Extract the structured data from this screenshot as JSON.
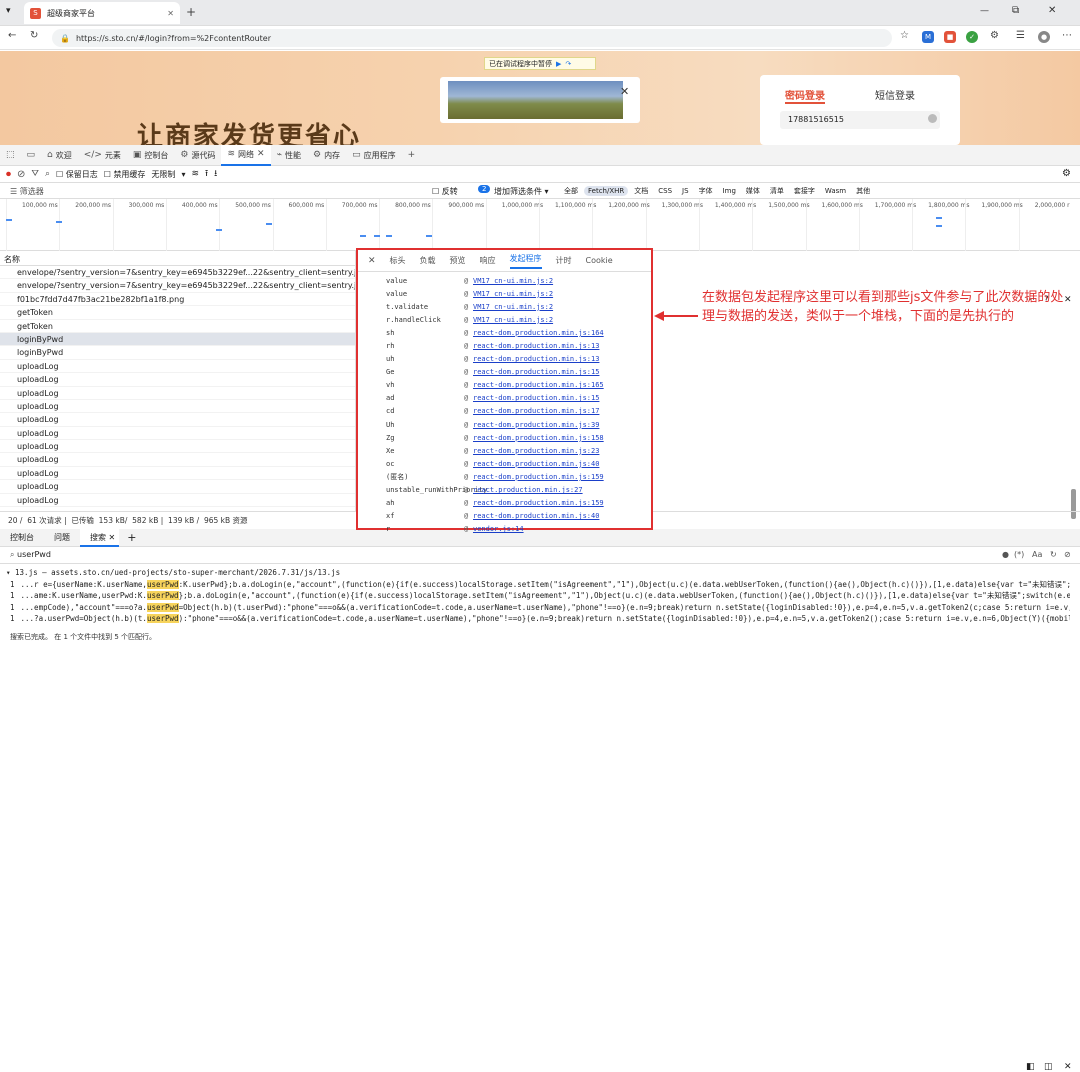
{
  "browser": {
    "tab_title": "超级商家平台",
    "url": "https://s.sto.cn/#/login?from=%2FcontentRouter"
  },
  "page": {
    "debug_banner": "已在调试程序中暂停",
    "slogan": "让商家发货更省心",
    "login_tab_active": "密码登录",
    "login_tab_other": "短信登录",
    "phone_value": "17881516515"
  },
  "devtools": {
    "tabs": [
      "欢迎",
      "元素",
      "控制台",
      "源代码",
      "网络",
      "性能",
      "内存",
      "应用程序"
    ],
    "toolbar": {
      "preserve_log": "保留日志",
      "disable_cache": "禁用缓存",
      "throttle": "无限制"
    },
    "filter": {
      "placeholder": "筛选器",
      "invert": "反转",
      "more_filters": "增加筛选条件",
      "badge": "2",
      "types": [
        "全部",
        "Fetch/XHR",
        "文档",
        "CSS",
        "JS",
        "字体",
        "Img",
        "媒体",
        "清单",
        "套接字",
        "Wasm",
        "其他"
      ]
    },
    "timeline_ticks": [
      "100,000 ms",
      "200,000 ms",
      "300,000 ms",
      "400,000 ms",
      "500,000 ms",
      "600,000 ms",
      "700,000 ms",
      "800,000 ms",
      "900,000 ms",
      "1,000,000 ms",
      "1,100,000 ms",
      "1,200,000 ms",
      "1,300,000 ms",
      "1,400,000 ms",
      "1,500,000 ms",
      "1,600,000 ms",
      "1,700,000 ms",
      "1,800,000 ms",
      "1,900,000 ms",
      "2,000,000 r"
    ],
    "requests_header": "名称",
    "requests": [
      "envelope/?sentry_version=7&sentry_key=e6945b3229ef...22&sentry_client=sentry.javas...",
      "envelope/?sentry_version=7&sentry_key=e6945b3229ef...22&sentry_client=sentry.javas...",
      "f01bc7fdd7d47fb3ac21be282bf1a1f8.png",
      "getToken",
      "getToken",
      "loginByPwd",
      "loginByPwd",
      "uploadLog",
      "uploadLog",
      "uploadLog",
      "uploadLog",
      "uploadLog",
      "uploadLog",
      "uploadLog",
      "uploadLog",
      "uploadLog",
      "uploadLog",
      "uploadLog"
    ],
    "status": {
      "count": "20 /",
      "requests": "61 次请求",
      "transferred": "已传输",
      "t1": "153 kB/",
      "t2": "582 kB",
      "t3": "139 kB /",
      "t4": "965 kB 资源"
    },
    "panel_tabs": [
      "标头",
      "负载",
      "预览",
      "响应",
      "发起程序",
      "计时",
      "Cookie"
    ],
    "initiator": [
      {
        "fn": "value",
        "src": "VM17 cn-ui.min.js:2"
      },
      {
        "fn": "value",
        "src": "VM17 cn-ui.min.js:2"
      },
      {
        "fn": "t.validate",
        "src": "VM17 cn-ui.min.js:2"
      },
      {
        "fn": "r.handleClick",
        "src": "VM17 cn-ui.min.js:2"
      },
      {
        "fn": "sh",
        "src": "react-dom.production.min.js:164"
      },
      {
        "fn": "rh",
        "src": "react-dom.production.min.js:13"
      },
      {
        "fn": "uh",
        "src": "react-dom.production.min.js:13"
      },
      {
        "fn": "Ge",
        "src": "react-dom.production.min.js:15"
      },
      {
        "fn": "vh",
        "src": "react-dom.production.min.js:165"
      },
      {
        "fn": "ad",
        "src": "react-dom.production.min.js:15"
      },
      {
        "fn": "cd",
        "src": "react-dom.production.min.js:17"
      },
      {
        "fn": "Uh",
        "src": "react-dom.production.min.js:39"
      },
      {
        "fn": "Zg",
        "src": "react-dom.production.min.js:158"
      },
      {
        "fn": "Xe",
        "src": "react-dom.production.min.js:23"
      },
      {
        "fn": "oc",
        "src": "react-dom.production.min.js:40"
      },
      {
        "fn": "(匿名)",
        "src": "react-dom.production.min.js:159"
      },
      {
        "fn": "unstable_runWithPriority",
        "src": "react.production.min.js:27"
      },
      {
        "fn": "ah",
        "src": "react-dom.production.min.js:159"
      },
      {
        "fn": "xf",
        "src": "react-dom.production.min.js:40"
      },
      {
        "fn": "r",
        "src": "vendor.js:14"
      }
    ],
    "drawer_tabs": [
      "控制台",
      "问题",
      "搜索"
    ],
    "search_query": "userPwd",
    "search_file": "▾ 13.js — assets.sto.cn/ued-projects/sto-super-merchant/2026.7.31/js/13.js",
    "search_results": [
      {
        "ln": "1",
        "pre": "...r e={userName:K.userName,",
        "hl": "userPwd",
        "post": ":K.userPwd};b.a.doLogin(e,\"account\",(function(e){if(e.success)localStorage.setItem(\"isAgreement\",\"1\"),Object(u.c)(e.data.webUserToken,(function(){ae(),Object(h.c)()}),[1,e.data)else{var t=\"未知错误\";switch(e.errorCode){case\"101\":t=\"您还没有注册，请..."
      },
      {
        "ln": "1",
        "pre": "...ame:K.userName,userPwd:K.",
        "hl": "userPwd",
        "post": "};b.a.doLogin(e,\"account\",(function(e){if(e.success)localStorage.setItem(\"isAgreement\",\"1\"),Object(u.c)(e.data.webUserToken,(function(){ae(),Object(h.c)()}),[1,e.data)else{var t=\"未知错误\";switch(e.errorCode){case\"101\":t=\"您还没有注册，请立即注册\";brea..."
      },
      {
        "ln": "1",
        "pre": "...empCode),\"account\"===o?a.",
        "hl": "userPwd",
        "post": "=Object(h.b)(t.userPwd):\"phone\"===o&&(a.verificationCode=t.code,a.userName=t.userName),\"phone\"!==o}(e.n=9;break)return n.setState({loginDisabled:!0}),e.p=4,e.n=5,v.a.getToken2(c;case 5:return i=e.v,e.n=6,Object(Y)({mobile:t.userName,acc..."
      },
      {
        "ln": "1",
        "pre": "...?a.userPwd=Object(h.b)(t.",
        "hl": "userPwd",
        "post": "):\"phone\"===o&&(a.verificationCode=t.code,a.userName=t.userName),\"phone\"!==o}(e.n=9;break)return n.setState({loginDisabled:!0}),e.p=4,e.n=5,v.a.getToken2();case 5:return i=e.v,e.n=6,Object(Y)({mobile:t.userName,accessToken:i.data});case 6:if(c..."
      }
    ],
    "search_summary": "搜索已完成。 在 1 个文件中找到 5 个匹配行。"
  },
  "annotation": "在数据包发起程序这里可以看到那些js文件参与了此次数据的处理与数据的发送，类似于一个堆栈，下面的是先执行的",
  "colors": {
    "accent": "#1a73e8",
    "highlight": "#e03030",
    "match": "#f7d45c"
  }
}
